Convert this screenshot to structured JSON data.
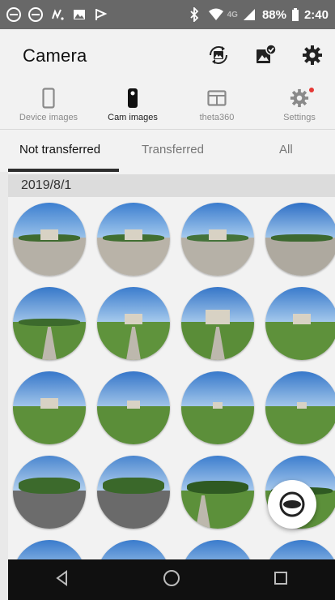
{
  "status_bar": {
    "network": "4G",
    "battery": "88%",
    "time": "2:40"
  },
  "app_bar": {
    "title": "Camera"
  },
  "nav_tabs": [
    {
      "label": "Device images",
      "icon": "phone-icon",
      "active": false
    },
    {
      "label": "Cam images",
      "icon": "camera-device-icon",
      "active": true
    },
    {
      "label": "theta360",
      "icon": "browser-icon",
      "active": false
    },
    {
      "label": "Settings",
      "icon": "gear-icon",
      "active": false,
      "badge": true
    }
  ],
  "sub_tabs": [
    {
      "label": "Not transferred",
      "active": true
    },
    {
      "label": "Transferred",
      "active": false
    },
    {
      "label": "All",
      "active": false
    }
  ],
  "date_header": "2019/8/1",
  "colors": {
    "status_bar": "#686868",
    "background": "#f2f2f2",
    "settings_badge": "#e53935",
    "tab_indicator": "#2d2d2d"
  }
}
